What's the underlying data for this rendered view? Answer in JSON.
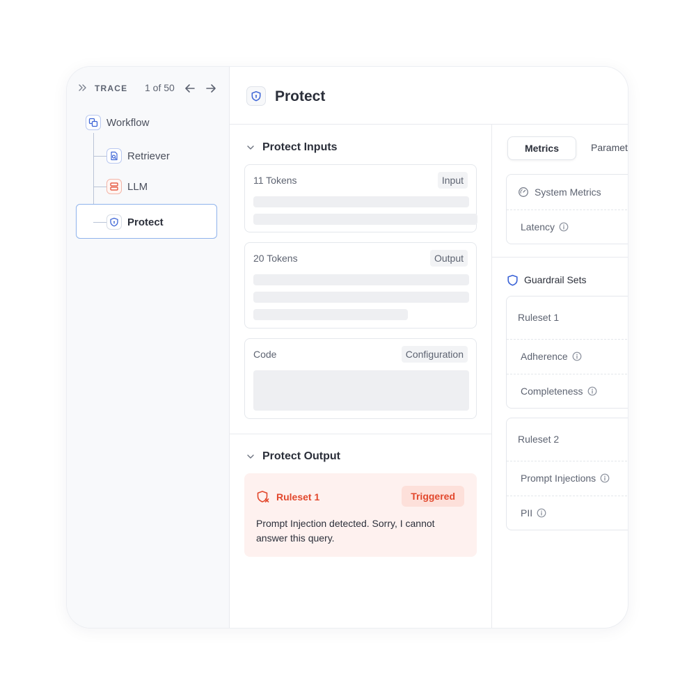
{
  "sidebar": {
    "trace_label": "TRACE",
    "trace_count": "1 of 50",
    "nodes": [
      {
        "label": "Workflow",
        "icon": "workflow-icon"
      },
      {
        "label": "Retriever",
        "icon": "retriever-icon"
      },
      {
        "label": "LLM",
        "icon": "llm-icon"
      },
      {
        "label": "Protect",
        "icon": "shield-icon",
        "selected": true
      }
    ]
  },
  "header": {
    "title": "Protect"
  },
  "inputs": {
    "section_title": "Protect Inputs",
    "cards": [
      {
        "label": "11 Tokens",
        "chip": "Input"
      },
      {
        "label": "20 Tokens",
        "chip": "Output"
      },
      {
        "label": "Code",
        "chip": "Configuration"
      }
    ]
  },
  "output": {
    "section_title": "Protect Output",
    "alert": {
      "title": "Ruleset 1",
      "badge": "Triggered",
      "message": "Prompt Injection detected. Sorry, I cannot answer this query."
    }
  },
  "right": {
    "tabs": [
      {
        "label": "Metrics",
        "active": true
      },
      {
        "label": "Parameters",
        "active": false
      }
    ],
    "system_metrics": {
      "title": "System Metrics",
      "rows": [
        "Latency"
      ]
    },
    "guardrail_title": "Guardrail Sets",
    "rulesets": [
      {
        "title": "Ruleset 1",
        "rows": [
          "Adherence",
          "Completeness"
        ]
      },
      {
        "title": "Ruleset 2",
        "rows": [
          "Prompt Injections",
          "PII"
        ]
      }
    ]
  },
  "colors": {
    "accent_blue": "#3b63d6",
    "alert_red": "#e2482d",
    "alert_bg": "#fef1ef",
    "selected_border": "#8fb3ec"
  }
}
